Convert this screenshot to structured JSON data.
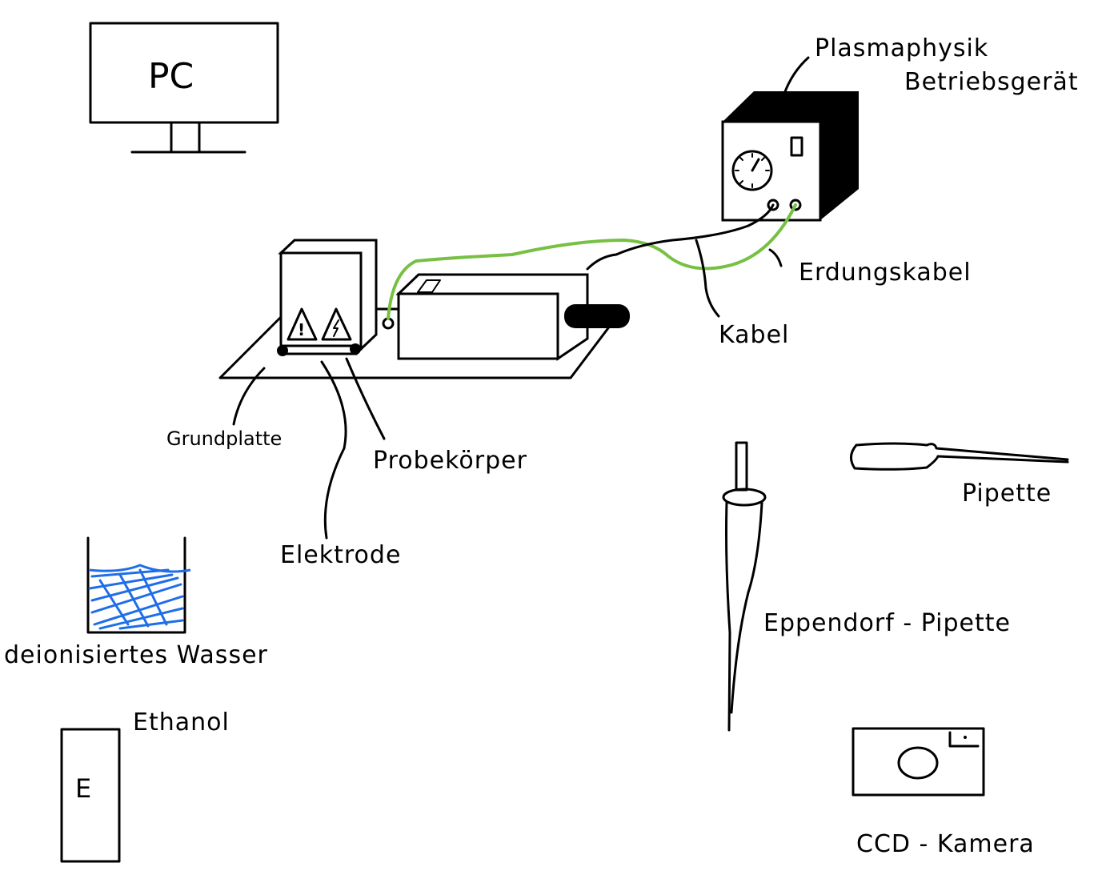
{
  "labels": {
    "pc": "PC",
    "device_line1": "Plasmaphysik",
    "device_line2": "Betriebsgerät",
    "ground_cable": "Erdungskabel",
    "cable": "Kabel",
    "base_plate": "Grundplatte",
    "specimen": "Probekörper",
    "electrode": "Elektrode",
    "water": "deionisiertes Wasser",
    "ethanol": "Ethanol",
    "ethanol_bottle_letter": "E",
    "eppendorf": "Eppendorf - Pipette",
    "pipette": "Pipette",
    "ccd": "CCD - Kamera"
  },
  "colors": {
    "line": "#000000",
    "ground_cable": "#77c043",
    "water": "#1e6ee8",
    "device_body": "#000000"
  }
}
